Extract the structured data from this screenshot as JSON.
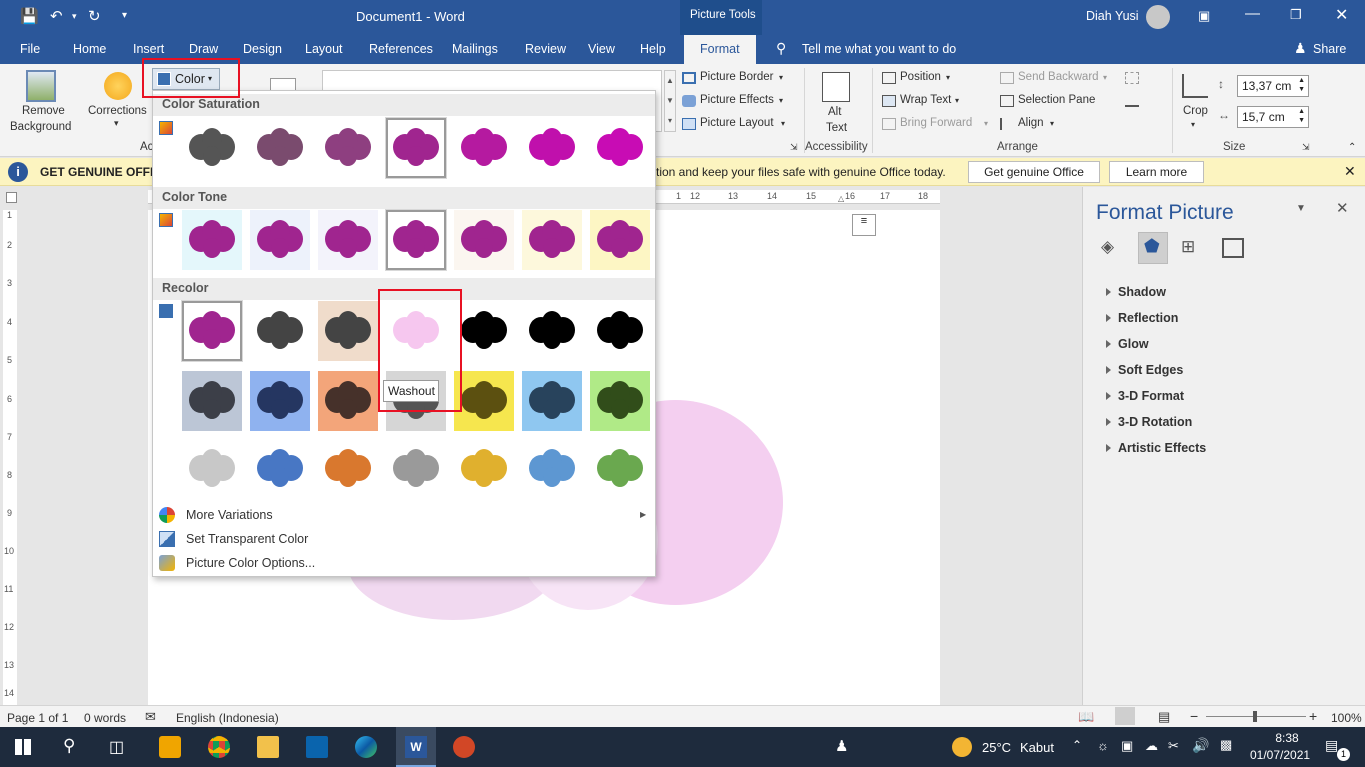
{
  "title": {
    "doc": "Document1",
    "sep": "-",
    "app": "Word",
    "context": "Picture Tools",
    "user": "Diah Yusi"
  },
  "tabs": [
    "File",
    "Home",
    "Insert",
    "Draw",
    "Design",
    "Layout",
    "References",
    "Mailings",
    "Review",
    "View",
    "Help",
    "Format"
  ],
  "tell_me": "Tell me what you want to do",
  "share": "Share",
  "ribbon": {
    "remove_bg": [
      "Remove",
      "Background"
    ],
    "corrections": "Corrections",
    "color": "Color",
    "adjust_short": "Ac",
    "picture_border": "Picture Border",
    "picture_effects": "Picture Effects",
    "picture_layout": "Picture Layout",
    "alt_text": [
      "Alt",
      "Text"
    ],
    "accessibility": "Accessibility",
    "position": "Position",
    "wrap_text": "Wrap Text",
    "bring_forward": "Bring Forward",
    "send_backward": "Send Backward",
    "selection_pane": "Selection Pane",
    "align": "Align",
    "arrange": "Arrange",
    "crop": "Crop",
    "height": "13,37 cm",
    "width": "15,7 cm",
    "size": "Size"
  },
  "message_bar": {
    "label": "GET GENUINE OFFICE",
    "text": "tion and keep your files safe with genuine Office today.",
    "btn1": "Get genuine Office",
    "btn2": "Learn more"
  },
  "ruler": {
    "h": [
      "1",
      "12",
      "13",
      "14",
      "15",
      "16",
      "17",
      "18"
    ],
    "v": [
      "1",
      "2",
      "3",
      "4",
      "5",
      "6",
      "7",
      "8",
      "9",
      "10",
      "11",
      "12",
      "13",
      "14"
    ]
  },
  "dropdown": {
    "sat_header": "Color Saturation",
    "tone_header": "Color Tone",
    "recolor_header": "Recolor",
    "more_variations": "More Variations",
    "set_transparent": "Set Transparent Color",
    "options": "Picture Color Options...",
    "tooltip": "Washout"
  },
  "pane": {
    "title": "Format Picture",
    "items": [
      "Shadow",
      "Reflection",
      "Glow",
      "Soft Edges",
      "3-D Format",
      "3-D Rotation",
      "Artistic Effects"
    ]
  },
  "status": {
    "page": "Page 1 of 1",
    "words": "0 words",
    "lang": "English (Indonesia)",
    "zoom": "100%"
  },
  "taskbar": {
    "weather_temp": "25°C",
    "weather_desc": "Kabut",
    "time": "8:38",
    "date": "01/07/2021",
    "notif": "1"
  },
  "colors": {
    "accent": "#2b579a",
    "msgbar": "#fcf4c0",
    "highlight": "#e81123"
  }
}
